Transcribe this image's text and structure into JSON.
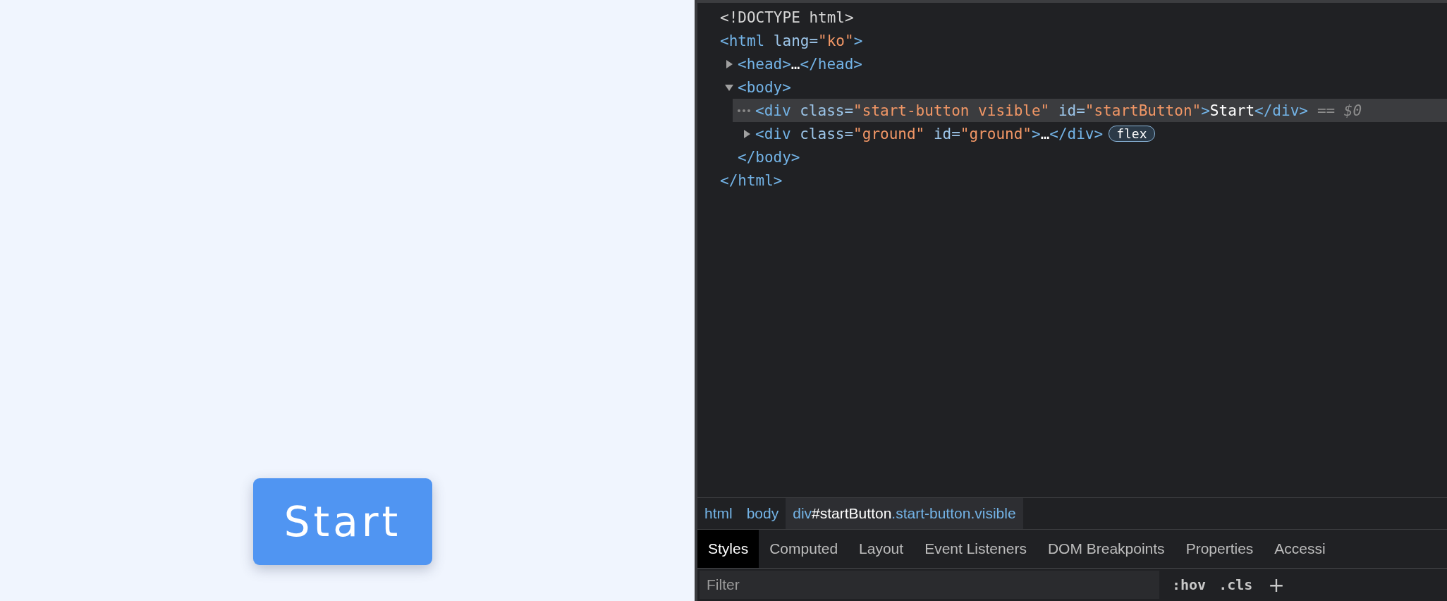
{
  "page": {
    "start_button": "Start"
  },
  "devtools": {
    "dom_tree": [
      {
        "selected": false,
        "segments": [
          {
            "kind": "doctype",
            "text": "<!DOCTYPE html>"
          }
        ]
      },
      {
        "selected": false,
        "segments": [
          {
            "kind": "tag",
            "text": "<html"
          },
          {
            "kind": "attr",
            "text": " lang="
          },
          {
            "kind": "value",
            "text": "\"ko\""
          },
          {
            "kind": "tag",
            "text": ">"
          }
        ],
        "children": [
          {
            "selected": false,
            "expanded": false,
            "segments": [
              {
                "kind": "tag",
                "text": "<head>"
              },
              {
                "kind": "text",
                "text": "…"
              },
              {
                "kind": "tag",
                "text": "</head>"
              }
            ]
          },
          {
            "selected": false,
            "expanded": true,
            "segments": [
              {
                "kind": "tag",
                "text": "<body>"
              }
            ],
            "children": [
              {
                "selected": true,
                "segments": [
                  {
                    "kind": "tag",
                    "text": "<div"
                  },
                  {
                    "kind": "attr",
                    "text": " class="
                  },
                  {
                    "kind": "value",
                    "text": "\"start-button visible\""
                  },
                  {
                    "kind": "attr",
                    "text": " id="
                  },
                  {
                    "kind": "value",
                    "text": "\"startButton\""
                  },
                  {
                    "kind": "tag",
                    "text": ">"
                  },
                  {
                    "kind": "text",
                    "text": "Start"
                  },
                  {
                    "kind": "tag",
                    "text": "</div>"
                  }
                ],
                "console_ref": "== $0"
              },
              {
                "selected": false,
                "expanded": false,
                "segments": [
                  {
                    "kind": "tag",
                    "text": "<div"
                  },
                  {
                    "kind": "attr",
                    "text": " class="
                  },
                  {
                    "kind": "value",
                    "text": "\"ground\""
                  },
                  {
                    "kind": "attr",
                    "text": " id="
                  },
                  {
                    "kind": "value",
                    "text": "\"ground\""
                  },
                  {
                    "kind": "tag",
                    "text": ">"
                  },
                  {
                    "kind": "text",
                    "text": "…"
                  },
                  {
                    "kind": "tag",
                    "text": "</div>"
                  }
                ],
                "badge": "flex"
              }
            ],
            "closing": [
              {
                "kind": "tag",
                "text": "</body>"
              }
            ]
          }
        ],
        "closing": [
          {
            "kind": "tag",
            "text": "</html>"
          }
        ]
      }
    ],
    "breadcrumbs": [
      {
        "selected": false,
        "segments": [
          {
            "kind": "tag",
            "text": "html"
          }
        ]
      },
      {
        "selected": false,
        "segments": [
          {
            "kind": "tag",
            "text": "body"
          }
        ]
      },
      {
        "selected": true,
        "segments": [
          {
            "kind": "tag",
            "text": "div"
          },
          {
            "kind": "id",
            "text": "#startButton"
          },
          {
            "kind": "tag",
            "text": ".start-button.visible"
          }
        ]
      }
    ],
    "tabs": [
      {
        "label": "Styles",
        "selected": true
      },
      {
        "label": "Computed",
        "selected": false
      },
      {
        "label": "Layout",
        "selected": false
      },
      {
        "label": "Event Listeners",
        "selected": false
      },
      {
        "label": "DOM Breakpoints",
        "selected": false
      },
      {
        "label": "Properties",
        "selected": false
      },
      {
        "label": "Accessi",
        "selected": false
      }
    ],
    "filter": {
      "placeholder": "Filter",
      "hov": ":hov",
      "cls": ".cls",
      "add": "+"
    }
  }
}
